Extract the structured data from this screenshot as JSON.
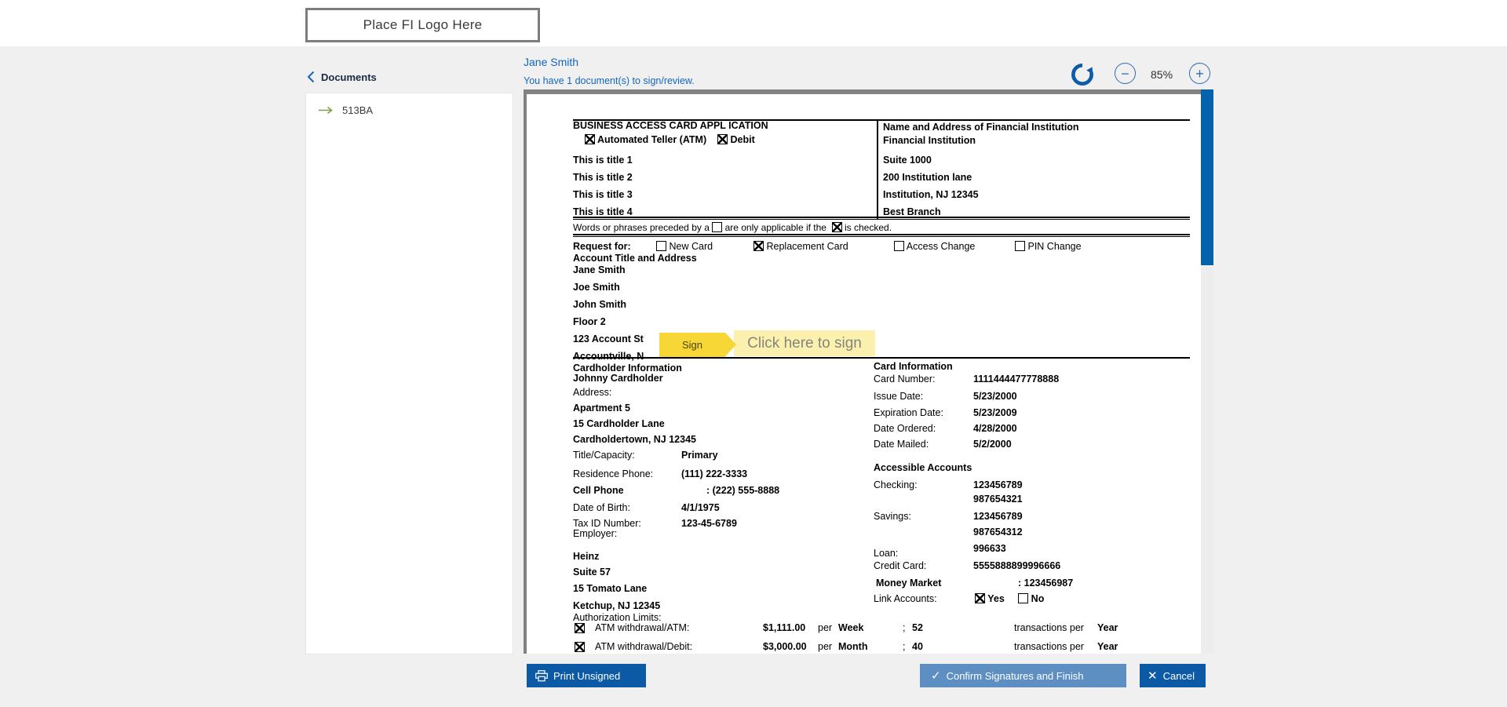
{
  "top_bar": {
    "logo_placeholder": "Place FI Logo Here"
  },
  "sidebar": {
    "back_label": "Documents",
    "items": [
      {
        "label": "513BA"
      }
    ]
  },
  "header": {
    "user_name": "Jane Smith",
    "notice": "You have 1 document(s) to sign/review.",
    "zoom_level": "85%",
    "zoom_out_glyph": "−",
    "zoom_in_glyph": "+"
  },
  "colors": {
    "accent_blue": "#0c59a6",
    "confirm_blue": "#5e8fc3",
    "link_blue": "#1665bd",
    "scrollbar_blue": "#0562ac",
    "sign_tag_yellow": "#f6d736",
    "sign_prompt_yellow": "#fcf0ae",
    "arrow_green": "#7e9e46"
  },
  "document": {
    "header": {
      "title": "BUSINESS ACCESS CARD APPL ICATION",
      "checkbox_atm": "Automated Teller (ATM)",
      "checkbox_debit": "Debit",
      "titles": [
        "This is title 1",
        "This is title 2",
        "This is title 3",
        "This is title 4"
      ],
      "fi_heading": "Name and Address of Financial Institution",
      "fi_lines": [
        "Financial Institution",
        "Suite 1000",
        "200 Institution lane",
        "Institution, NJ 12345",
        "Best Branch"
      ]
    },
    "conditional_note": {
      "pre": "Words or phrases preceded by a",
      "mid": "are only applicable if the",
      "post": "is checked."
    },
    "request": {
      "label": "Request for:",
      "options": [
        {
          "label": "New Card",
          "checked": false
        },
        {
          "label": "Replacement Card",
          "checked": true
        },
        {
          "label": "Access Change",
          "checked": false
        },
        {
          "label": "PIN Change",
          "checked": false
        }
      ]
    },
    "account_title": {
      "heading": "Account Title and Address",
      "lines": [
        "Jane Smith",
        "Joe Smith",
        "John Smith",
        "Floor 2",
        "123 Account St",
        "Accountville, N"
      ]
    },
    "sign": {
      "tag": "Sign",
      "prompt": "Click here to sign"
    },
    "cardholder": {
      "heading": "Cardholder Information",
      "name": "Johnny Cardholder",
      "address_label": "Address:",
      "address_lines": [
        "Apartment 5",
        "15 Cardholder Lane",
        "Cardholdertown, NJ 12345"
      ],
      "title_capacity_label": "Title/Capacity:",
      "title_capacity": "Primary",
      "residence_phone_label": "Residence Phone:",
      "residence_phone": "(111) 222-3333",
      "cell_phone_label": "Cell Phone",
      "cell_phone": ": (222) 555-8888",
      "dob_label": "Date of Birth:",
      "dob": "4/1/1975",
      "tax_id_label": "Tax ID Number:",
      "tax_id": "123-45-6789",
      "employer_label": "Employer:",
      "employer_lines": [
        "Heinz",
        "Suite 57",
        "15 Tomato Lane",
        "Ketchup, NJ 12345"
      ]
    },
    "card_info": {
      "heading": "Card Information",
      "card_number_label": "Card Number:",
      "card_number": "1111444477778888",
      "issue_date_label": "Issue Date:",
      "issue_date": "5/23/2000",
      "expiration_date_label": "Expiration Date:",
      "expiration_date": "5/23/2009",
      "date_ordered_label": "Date Ordered:",
      "date_ordered": "4/28/2000",
      "date_mailed_label": "Date Mailed:",
      "date_mailed": "5/2/2000"
    },
    "accessible_accounts": {
      "heading": "Accessible Accounts",
      "checking_label": "Checking:",
      "checking_1": "123456789",
      "checking_2": "987654321",
      "savings_label": "Savings:",
      "savings_1": "123456789",
      "savings_2": "987654312",
      "loan_label": "Loan:",
      "loan": "996633",
      "credit_card_label": "Credit Card:",
      "credit_card": "5555888899996666",
      "money_market_label": "Money Market",
      "money_market": ": 123456987",
      "link_accounts_label": "Link Accounts:",
      "link_yes": "Yes",
      "link_no": "No"
    },
    "authorization": {
      "heading": "Authorization Limits:",
      "rows": [
        {
          "label": "ATM withdrawal/ATM:",
          "amount": "$1,111.00",
          "per": "per",
          "period": "Week",
          "semi": ";",
          "count": "52",
          "trans": "transactions per",
          "unit": "Year"
        },
        {
          "label": "ATM withdrawal/Debit:",
          "amount": "$3,000.00",
          "per": "per",
          "period": "Month",
          "semi": ";",
          "count": "40",
          "trans": "transactions per",
          "unit": "Year"
        }
      ]
    }
  },
  "footer": {
    "print_label": "Print Unsigned",
    "confirm_label": "Confirm Signatures and Finish",
    "cancel_label": "Cancel"
  }
}
